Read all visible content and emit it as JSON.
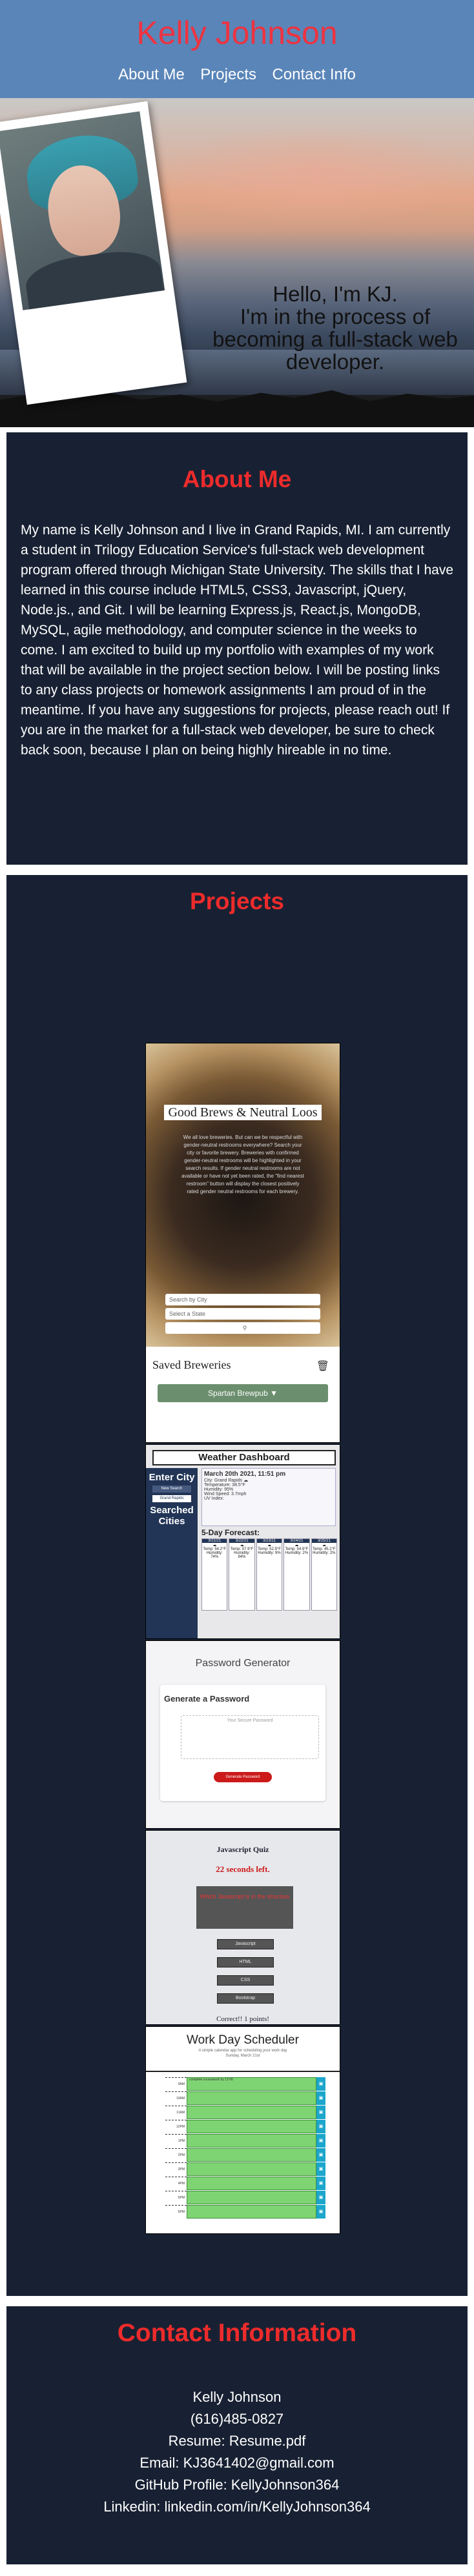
{
  "header": {
    "title": "Kelly Johnson",
    "nav": [
      "About Me",
      "Projects",
      "Contact Info"
    ]
  },
  "hero": {
    "lines": [
      "Hello, I'm KJ.",
      "I'm in the process of",
      "becoming a full-stack web",
      "developer."
    ]
  },
  "about": {
    "title": "About Me",
    "text": "My name is Kelly Johnson and I live in Grand Rapids, MI. I am currently a student in Trilogy Education Service's full-stack web development program offered through Michigan State University. The skills that I have learned in this course include HTML5, CSS3, Javascript, jQuery, Node.js., and Git. I will be learning Express.js, React.js, MongoDB, MySQL, agile methodology, and computer science in the weeks to come. I am excited to build up my portfolio with examples of my work that will be available in the project section below. I will be posting links to any class projects or homework assignments I am proud of in the meantime. If you have any suggestions for projects, please reach out! If you are in the market for a full-stack web developer, be sure to check back soon, because I plan on being highly hireable in no time."
  },
  "projects": {
    "title": "Projects",
    "items": [
      {
        "name": "Good Brews & Neutral Loos",
        "blurb": "We all love breweries. But can we be respectful with gender-neutral restrooms everywhere? Search your city or favorite brewery. Breweries with confirmed gender-neutral restrooms will be highlighted in your search results. If gender neutral restrooms are not available or have not yet been rated, the \"find nearest restroom\" button will display the closest positively rated gender neutral restrooms for each brewery.",
        "input1": "Search by City",
        "input2": "Select a State",
        "search_icon": "search-icon",
        "saved_title": "Saved Breweries",
        "saved_item": "Spartan Brewpub"
      },
      {
        "name": "Weather Dashboard",
        "sidebar_title": "Enter City",
        "sidebar_buttons": [
          "New Search",
          "Grand Rapids"
        ],
        "searched_title": "Searched Cities",
        "date": "March 20th 2021, 11:51 pm",
        "city": "City: Grand Rapids",
        "stats": [
          "Temperature: 38.5°F",
          "Humidity: 95%",
          "Wind Speed: 3.7mph",
          "UV Index:"
        ],
        "forecast_title": "5-Day Forecast:",
        "forecast": [
          {
            "date": "3/21/21",
            "temp": "Temp: 54.2°F",
            "hum": "Humidity: 74%"
          },
          {
            "date": "3/22/21",
            "temp": "Temp: 57.9°F",
            "hum": "Humidity: 84%"
          },
          {
            "date": "3/23/21",
            "temp": "Temp: 52.9°F",
            "hum": "Humidity: 9%"
          },
          {
            "date": "3/24/21",
            "temp": "Temp: 54.9°F",
            "hum": "Humidity: 2%"
          },
          {
            "date": "3/25/21",
            "temp": "Temp: 45.2°F",
            "hum": "Humidity: 2%"
          }
        ]
      },
      {
        "name": "Password Generator",
        "subtitle": "Generate a Password",
        "placeholder": "Your Secure Password",
        "button": "Generate Password"
      },
      {
        "name": "Javascript Quiz",
        "timer": "22 seconds left.",
        "question": "Which Javascript is in the structure",
        "options": [
          "Javascript",
          "HTML",
          "CSS",
          "Bootstrap"
        ],
        "result": "Correct!! 1 points!"
      },
      {
        "name": "Work Day Scheduler",
        "subtitle": "A simple calendar app for scheduling your work day",
        "date": "Sunday, March 21st",
        "hours": [
          "9AM",
          "10AM",
          "11AM",
          "12PM",
          "1PM",
          "2PM",
          "3PM",
          "4PM",
          "5PM",
          "6PM"
        ],
        "first_event": "complete coursework by 12:00"
      }
    ]
  },
  "contact": {
    "title": "Contact Information",
    "name": "Kelly Johnson",
    "phone": "(616)485-0827",
    "resume": "Resume: Resume.pdf",
    "email": "Email: KJ3641402@gmail.com",
    "github": "GitHub Profile: KellyJohnson364",
    "linkedin": "Linkedin: linkedin.com/in/KellyJohnson364"
  },
  "colors": {
    "header_bg": "#5a85b8",
    "accent_red": "#ee3340",
    "panel_bg": "#182133"
  }
}
